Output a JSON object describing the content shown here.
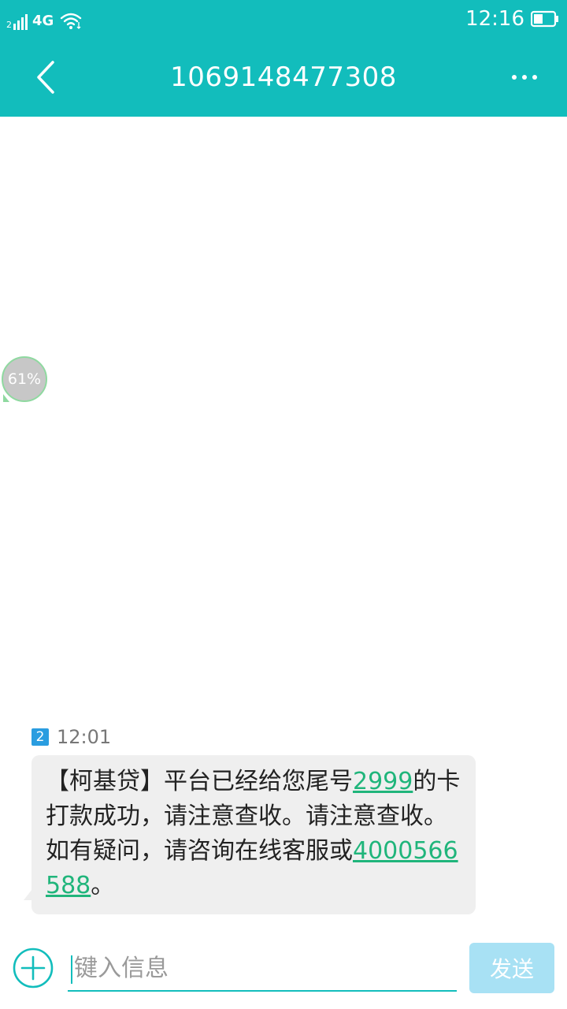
{
  "status_bar": {
    "sim_number": "2",
    "network_type": "4G",
    "time": "12:16",
    "signal_icon": "signal-icon",
    "wifi_icon": "wifi-icon",
    "battery_icon": "battery-icon"
  },
  "header": {
    "title": "1069148477308",
    "back_icon": "back-arrow-icon",
    "more_icon": "more-dots-icon",
    "color": "#12bdbc"
  },
  "float_ball": {
    "label": "61%"
  },
  "message": {
    "sim_badge": "2",
    "time": "12:01",
    "text_1": "【柯基贷】平台已经给您尾号",
    "card_tail": "2999",
    "text_2": "的卡打款成功，请注意查收。请注意查收。如有疑问，请咨询在线客服或",
    "phone": "4000566588",
    "text_3": "。",
    "link_color": "#20b57b"
  },
  "composer": {
    "add_icon": "plus-circle-icon",
    "placeholder": "键入信息",
    "value": "",
    "send_label": "发送"
  }
}
